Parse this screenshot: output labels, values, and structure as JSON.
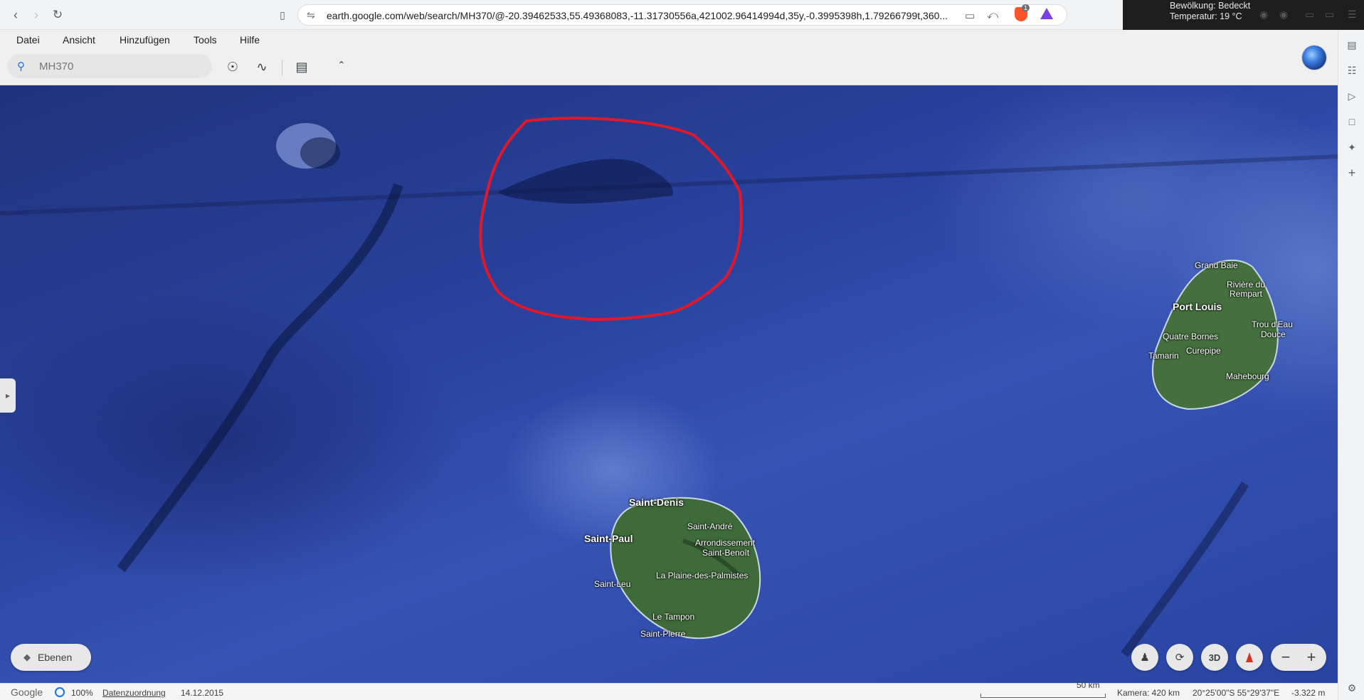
{
  "browser": {
    "url": "earth.google.com/web/search/MH370/@-20.39462533,55.49368083,-11.31730556a,421002.96414994d,35y,-0.3995398h,1.79266799t,360...",
    "brave_badge": "1",
    "weather": {
      "line1": "Bewölkung: Bedeckt",
      "line2": "Temperatur: 19 °C"
    }
  },
  "menu": {
    "items": [
      "Datei",
      "Ansicht",
      "Hinzufügen",
      "Tools",
      "Hilfe"
    ]
  },
  "search": {
    "placeholder": "MH370"
  },
  "map": {
    "places": {
      "saint_denis": "Saint-Denis",
      "saint_andre": "Saint-André",
      "saint_paul": "Saint-Paul",
      "arrondissement": "Arrondissement",
      "saint_benoit": "Saint-Benoît",
      "plaine": "La Plaine-des-Palmistes",
      "saint_leu": "Saint-Leu",
      "le_tampon": "Le Tampon",
      "saint_pierre": "Saint-Pierre",
      "grand_baie": "Grand Baie",
      "riviere1": "Rivière du",
      "riviere2": "Rempart",
      "port_louis": "Port Louis",
      "trou1": "Trou d'Eau",
      "trou2": "Douce",
      "quatre_bornes": "Quatre Bornes",
      "curepipe": "Curepipe",
      "tamarin": "Tamarin",
      "mahebourg": "Mahebourg"
    },
    "annotation_color": "#e0182a"
  },
  "controls": {
    "layers_label": "Ebenen",
    "view3d_label": "3D"
  },
  "status": {
    "brand": "Google",
    "loaded": "100%",
    "data_link": "Datenzuordnung",
    "date": "14.12.2015",
    "scale": "50 km",
    "camera": "Kamera: 420 km",
    "coords": "20°25'00\"S 55°29'37\"E",
    "elevation": "-3.322 m"
  }
}
